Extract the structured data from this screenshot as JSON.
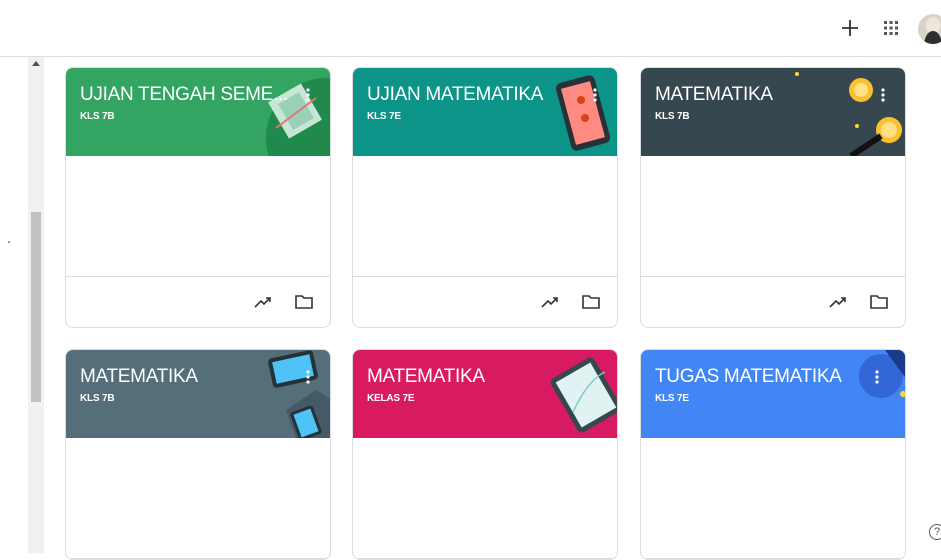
{
  "topbar": {
    "create_icon": "plus-icon",
    "apps_icon": "apps-grid-icon",
    "avatar_icon": "user-avatar"
  },
  "cards": [
    {
      "title": "UJIAN TENGAH SEME...",
      "subtitle": "KLS 7B",
      "color": "#34a463"
    },
    {
      "title": "UJIAN MATEMATIKA",
      "subtitle": "KLS 7E",
      "color": "#0d9488"
    },
    {
      "title": "MATEMATIKA",
      "subtitle": "KLS 7B",
      "color": "#37474f"
    },
    {
      "title": "MATEMATIKA",
      "subtitle": "KLS 7B",
      "color": "#546e7a"
    },
    {
      "title": "MATEMATIKA",
      "subtitle": "KELAS 7E",
      "color": "#d81b60"
    },
    {
      "title": "TUGAS MATEMATIKA",
      "subtitle": "KLS 7E",
      "color": "#4285f4"
    }
  ],
  "footer_icons": {
    "trend": "trending-icon",
    "folder": "folder-icon"
  },
  "help_label": "?"
}
